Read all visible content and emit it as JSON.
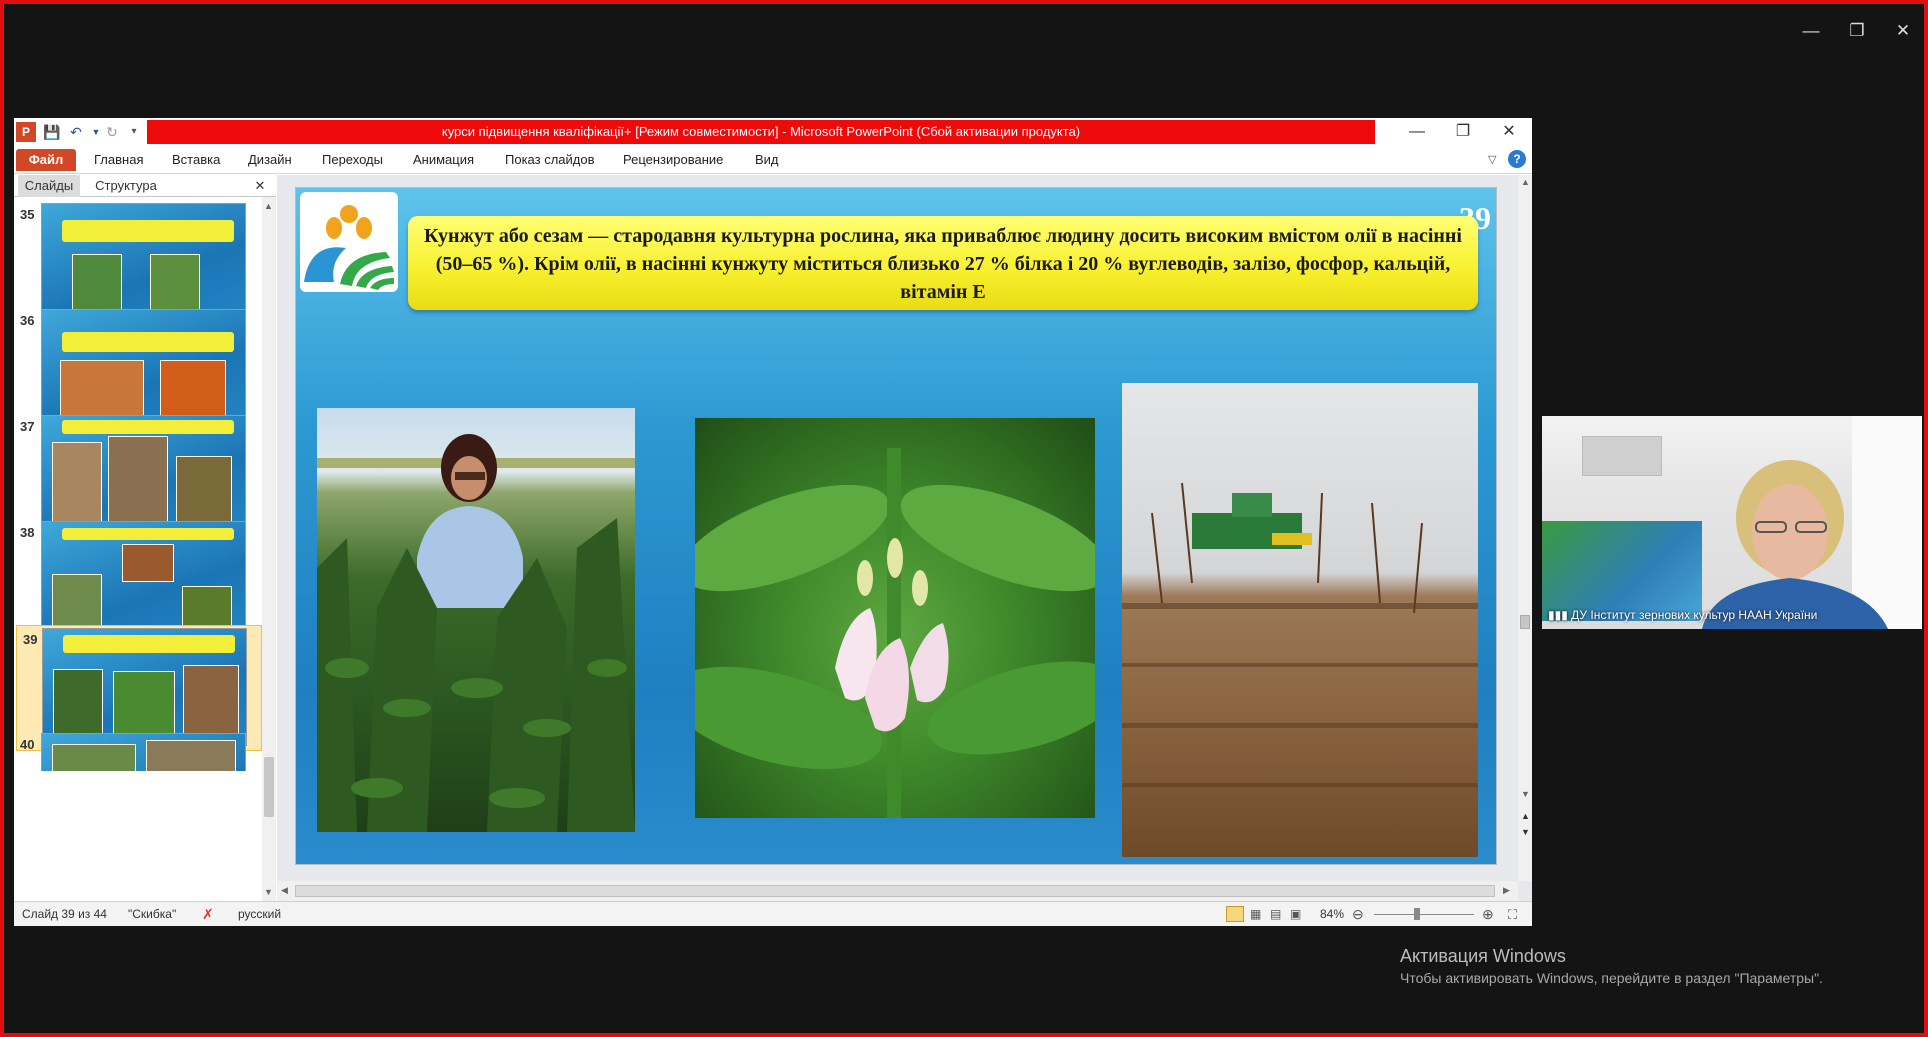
{
  "window": {
    "title": "курси підвищення кваліфікації+ [Режим совместимости] - Microsoft PowerPoint (Сбой активации продукта)"
  },
  "ribbon": {
    "file": "Файл",
    "tabs": [
      "Главная",
      "Вставка",
      "Дизайн",
      "Переходы",
      "Анимация",
      "Показ слайдов",
      "Рецензирование",
      "Вид"
    ]
  },
  "panel": {
    "tabs": [
      "Слайды",
      "Структура"
    ],
    "thumbnails": [
      "35",
      "36",
      "37",
      "38",
      "39",
      "40"
    ],
    "selected": "39"
  },
  "slide": {
    "number": "39",
    "text": "Кунжут або сезам — стародавня культурна рослина, яка приваблює людину досить високим вмістом олії в насінні (50–65 %). Крім олії, в насінні кунжуту міститься близько 27 % білка і 20 % вуглеводів, залізо, фосфор, кальцій, вітамін Е"
  },
  "status": {
    "slide_info": "Слайд 39 из 44",
    "theme": "\"Скибка\"",
    "language": "русский",
    "zoom": "84%"
  },
  "video": {
    "name": "ДУ Інститут зернових культур НААН України"
  },
  "activation": {
    "title": "Активация Windows",
    "subtitle": "Чтобы активировать Windows, перейдите в раздел \"Параметры\"."
  }
}
